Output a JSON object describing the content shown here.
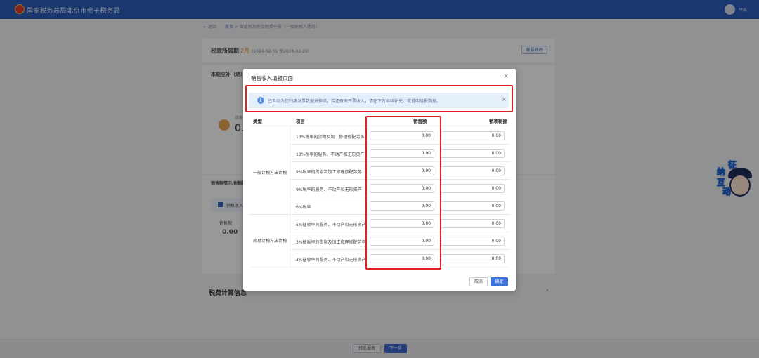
{
  "topbar": {
    "site_title": "国家税务总局北京市电子税务局",
    "user_name": "**局"
  },
  "breadcrumb": {
    "back": "← 返回",
    "home": "首页",
    "sep": ">",
    "page": "增值税及附加税费申报（一般纳税人适用）"
  },
  "background": {
    "period_label": "税款所属期",
    "period_badge": "2月",
    "period_range": "(2024-02-01 至2024-02-29)",
    "top_right_button": "我要修改",
    "section1_title": "本期应补（退）",
    "amount_prefix": "0.",
    "side_label": "应补",
    "section2_title": "销售额情况/税额核查",
    "sub_card_title": "销售收入",
    "sales_label": "销售额",
    "sales_value": "0.00",
    "section3_title": "税费计算信息",
    "chevron": "›"
  },
  "footer": {
    "prev_button": "预览报表",
    "next_button": "下一步"
  },
  "mascot": {
    "chars": [
      "征",
      "纳",
      "互",
      "动"
    ]
  },
  "modal": {
    "title": "销售收入填报页面",
    "close_icon": "×",
    "notice_icon": "i",
    "notice_text": "已自动为您归集发票数据并预填，若还有未开票收入，请在下方继续补充。或说明填报数据。",
    "notice_close": "×",
    "columns": {
      "type": "类型",
      "item": "项目",
      "sales": "销售额",
      "tax": "销项税额"
    },
    "groups": [
      {
        "label": "一般计税方法计税",
        "rows": [
          {
            "item": "13%税率的货物及加工修理修配劳务",
            "sales": "0.00",
            "tax": "0.00"
          },
          {
            "item": "13%税率的服务、不动产和无形资产",
            "sales": "0.00",
            "tax": "0.00"
          },
          {
            "item": "9%税率的货物及加工修理修配劳务",
            "sales": "0.00",
            "tax": "0.00"
          },
          {
            "item": "9%税率的服务、不动产和无形资产",
            "sales": "0.00",
            "tax": "0.00"
          },
          {
            "item": "6%税率",
            "sales": "0.00",
            "tax": "0.00"
          }
        ]
      },
      {
        "label": "简易计税方法计税",
        "rows": [
          {
            "item": "5%征收率的服务、不动产和无形资产",
            "sales": "0.00",
            "tax": "0.00"
          },
          {
            "item": "3%征收率的货物及加工修理修配劳务",
            "sales": "0.00",
            "tax": "0.00"
          },
          {
            "item": "3%征收率的服务、不动产和无形资产",
            "sales": "0.00",
            "tax": "0.00"
          }
        ]
      }
    ],
    "cancel_button": "取消",
    "ok_button": "确定"
  },
  "colors": {
    "topbar": "#2a5bb3",
    "primary_button": "#3a72d8",
    "highlight_box": "#e02020",
    "notice_bg": "#e5eefb"
  }
}
